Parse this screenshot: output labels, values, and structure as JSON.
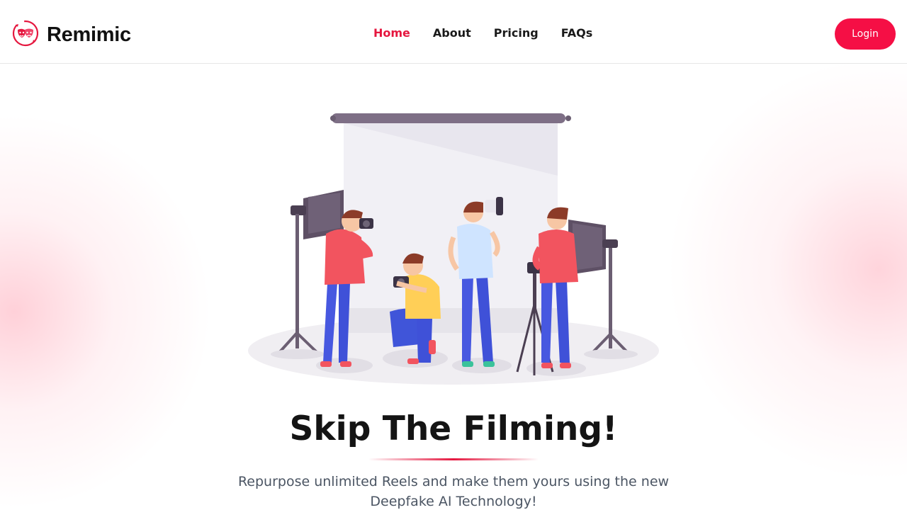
{
  "brand": {
    "name": "Remimic",
    "logo_icon": "theater-masks-icon",
    "accent_color": "#e5173f"
  },
  "nav": {
    "items": [
      {
        "label": "Home",
        "active": true
      },
      {
        "label": "About",
        "active": false
      },
      {
        "label": "Pricing",
        "active": false
      },
      {
        "label": "FAQs",
        "active": false
      }
    ]
  },
  "header": {
    "login_label": "Login",
    "login_color": "#f50f45"
  },
  "hero": {
    "title": "Skip The Filming!",
    "subtitle_line1": "Repurpose unlimited Reels and make them yours using the new",
    "subtitle_line2": "Deepfake AI Technology!",
    "illustration_icon": "photo-studio-illustration"
  }
}
